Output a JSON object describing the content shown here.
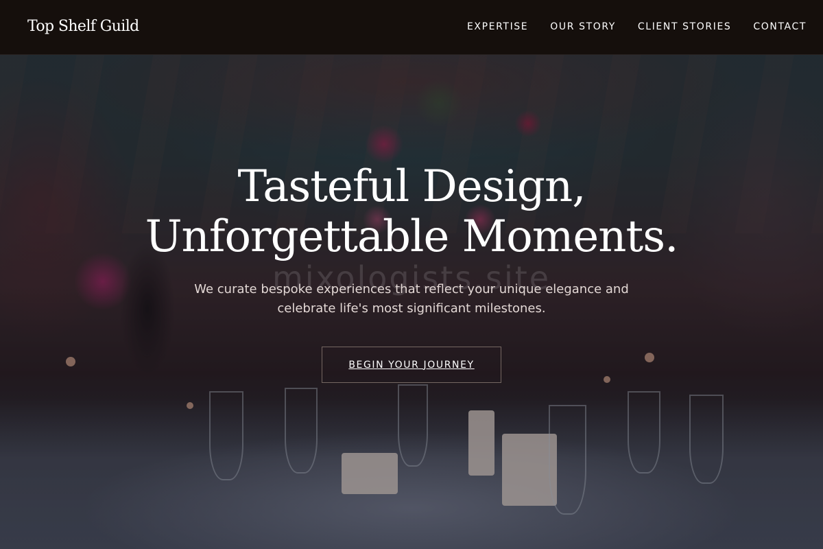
{
  "header": {
    "brand": "Top Shelf Guild",
    "nav": [
      {
        "label": "EXPERTISE"
      },
      {
        "label": "OUR STORY"
      },
      {
        "label": "CLIENT STORIES"
      },
      {
        "label": "CONTACT"
      }
    ]
  },
  "hero": {
    "title_line1": "Tasteful Design,",
    "title_line2": "Unforgettable Moments.",
    "watermark": "mixologists.site",
    "subtitle": "We curate bespoke experiences that reflect your unique elegance and celebrate life's most significant milestones.",
    "cta_label": "BEGIN YOUR JOURNEY"
  },
  "colors": {
    "header_bg": "#150f0c",
    "text": "#ffffff",
    "subtitle_text": "#e3d8d5"
  }
}
